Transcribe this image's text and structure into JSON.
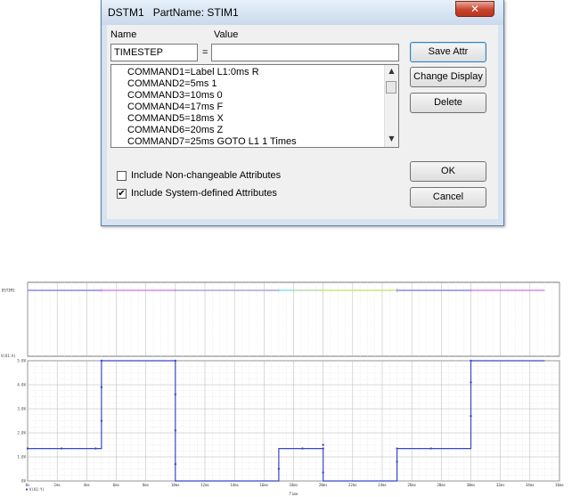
{
  "dialog": {
    "title": "DSTM1",
    "part_name_label": "PartName:",
    "part_name_value": "STIM1",
    "close_glyph": "✕",
    "name_header": "Name",
    "value_header": "Value",
    "name_value": "TIMESTEP",
    "equals": "=",
    "value_value": "",
    "list_items": [
      "COMMAND1=Label L1:0ms R",
      "COMMAND2=5ms 1",
      "COMMAND3=10ms 0",
      "COMMAND4=17ms F",
      "COMMAND5=18ms X",
      "COMMAND6=20ms Z",
      "COMMAND7=25ms GOTO L1 1 Times"
    ],
    "buttons": {
      "save_attr": "Save Attr",
      "change_display": "Change Display",
      "delete": "Delete",
      "ok": "OK",
      "cancel": "Cancel"
    },
    "checkboxes": {
      "non_changeable": {
        "label": "Include Non-changeable Attributes",
        "checked": false
      },
      "system_defined": {
        "label": "Include System-defined Attributes",
        "checked": true
      }
    },
    "icons": {
      "scroll_up": "up-arrow-icon",
      "scroll_down": "down-arrow-icon",
      "close": "close-icon"
    }
  },
  "chart_data": {
    "type": "line",
    "digital_trace_label": "DSTIM1",
    "analog_trace_label": "V(U1:A)",
    "legend_text": "V(U1:Y)",
    "xlabel": "Time",
    "xlim": [
      0,
      36
    ],
    "ylim": [
      0,
      5
    ],
    "x_ticks": [
      "0s",
      "2ms",
      "4ms",
      "6ms",
      "8ms",
      "10ms",
      "12ms",
      "14ms",
      "16ms",
      "18ms",
      "20ms",
      "22ms",
      "24ms",
      "26ms",
      "28ms",
      "30ms",
      "32ms",
      "34ms",
      "36ms"
    ],
    "y_ticks": [
      "0V",
      "1.0V",
      "2.0V",
      "3.0V",
      "4.0V",
      "5.0V"
    ],
    "colors": {
      "trace": "#3a46c8",
      "digital": "#8080e0",
      "grid": "#c8c8c8"
    },
    "digital_segments": [
      {
        "x0": 0,
        "x1": 5,
        "color": "#8a8ae6"
      },
      {
        "x0": 5,
        "x1": 10,
        "color": "#d68be0"
      },
      {
        "x0": 10,
        "x1": 17,
        "color": "#a9a9d6"
      },
      {
        "x0": 17,
        "x1": 18,
        "color": "#8fdfe9"
      },
      {
        "x0": 18,
        "x1": 20,
        "color": "#b4dfb4"
      },
      {
        "x0": 20,
        "x1": 25,
        "color": "#c6ea7a"
      },
      {
        "x0": 25,
        "x1": 30,
        "color": "#8a8ae6"
      },
      {
        "x0": 30,
        "x1": 35,
        "color": "#d68be0"
      }
    ],
    "series": [
      {
        "x": [
          0,
          2.3,
          4.6,
          5,
          5,
          10,
          10,
          17,
          17,
          18.6,
          20,
          20,
          25,
          25,
          27.3,
          30,
          30,
          35
        ],
        "y": [
          1.35,
          1.35,
          1.35,
          1.35,
          5,
          5,
          0,
          0,
          1.35,
          1.35,
          1.35,
          0,
          0,
          1.35,
          1.35,
          1.35,
          5,
          5
        ]
      }
    ],
    "markers": {
      "x": [
        0,
        2.3,
        4.6,
        5,
        5,
        5,
        10,
        10,
        10,
        10,
        17,
        18.6,
        20,
        20,
        20,
        25,
        25,
        27.3,
        30,
        30,
        30
      ],
      "y": [
        1.35,
        1.35,
        1.35,
        2.5,
        3.9,
        5,
        3.6,
        2.1,
        0.7,
        5,
        0.5,
        1.35,
        1.5,
        1.35,
        0.35,
        0.8,
        1.35,
        1.35,
        2.7,
        4.1,
        5
      ]
    }
  }
}
